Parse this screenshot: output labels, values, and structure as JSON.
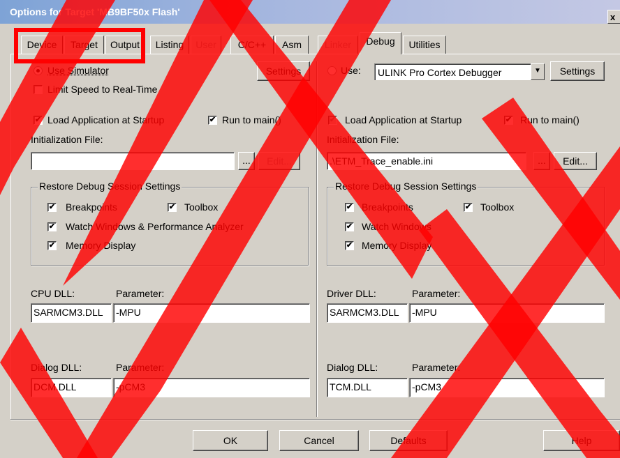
{
  "window": {
    "title": "Options for Target 'MB9BF50x Flash'",
    "close_label": "x"
  },
  "tabs": [
    {
      "label": "Device",
      "state": "normal"
    },
    {
      "label": "Target",
      "state": "normal"
    },
    {
      "label": "Output",
      "state": "normal"
    },
    {
      "label": "Listing",
      "state": "normal"
    },
    {
      "label": "User",
      "state": "disabled"
    },
    {
      "label": "C/C++",
      "state": "normal"
    },
    {
      "label": "Asm",
      "state": "normal"
    },
    {
      "label": "Linker",
      "state": "disabled"
    },
    {
      "label": "Debug",
      "state": "active"
    },
    {
      "label": "Utilities",
      "state": "normal"
    }
  ],
  "left": {
    "use_simulator_label": "Use Simulator",
    "use_simulator_selected": true,
    "settings_label": "Settings",
    "limit_speed_label": "Limit Speed to Real-Time",
    "limit_speed_checked": false,
    "load_app_label": "Load Application at Startup",
    "load_app_checked": true,
    "run_to_main_label": "Run to main()",
    "run_to_main_checked": true,
    "init_file_label": "Initialization File:",
    "init_file_value": "",
    "browse_label": "...",
    "edit_label": "Edit...",
    "restore_group_label": "Restore Debug Session Settings",
    "breakpoints_label": "Breakpoints",
    "toolbox_label": "Toolbox",
    "watch_label": "Watch Windows & Performance Analyzer",
    "memory_label": "Memory Display",
    "cpu_dll_label": "CPU DLL:",
    "cpu_dll_value": "SARMCM3.DLL",
    "cpu_param_label": "Parameter:",
    "cpu_param_value": "-MPU",
    "dialog_dll_label": "Dialog DLL:",
    "dialog_dll_value": "DCM.DLL",
    "dialog_param_label": "Parameter:",
    "dialog_param_value": "-pCM3"
  },
  "right": {
    "use_label": "Use:",
    "use_selected": false,
    "debugger_value": "ULINK Pro Cortex Debugger",
    "settings_label": "Settings",
    "load_app_label": "Load Application at Startup",
    "run_to_main_label": "Run to main()",
    "init_file_label": "Initialization File:",
    "init_file_value": ".\\ETM_Trace_enable.ini",
    "browse_label": "...",
    "edit_label": "Edit...",
    "restore_group_label": "Restore Debug Session Settings",
    "breakpoints_label": "Breakpoints",
    "toolbox_label": "Toolbox",
    "watch_label": "Watch Windows",
    "memory_label": "Memory Display",
    "driver_dll_label": "Driver DLL:",
    "driver_dll_value": "SARMCM3.DLL",
    "driver_param_label": "Parameter:",
    "driver_param_value": "-MPU",
    "dialog_dll_label": "Dialog DLL:",
    "dialog_dll_value": "TCM.DLL",
    "dialog_param_label": "Parameter:",
    "dialog_param_value": "-pCM3"
  },
  "footer": {
    "ok_label": "OK",
    "cancel_label": "Cancel",
    "defaults_label": "Defaults",
    "help_label": "Help"
  },
  "check_mark": "✔",
  "colors": {
    "annotation_red": "#ff0000",
    "watermark_red": "#ff0000",
    "titlebar": "#7ea3d6",
    "dialog_bg": "#d4d0c8"
  }
}
